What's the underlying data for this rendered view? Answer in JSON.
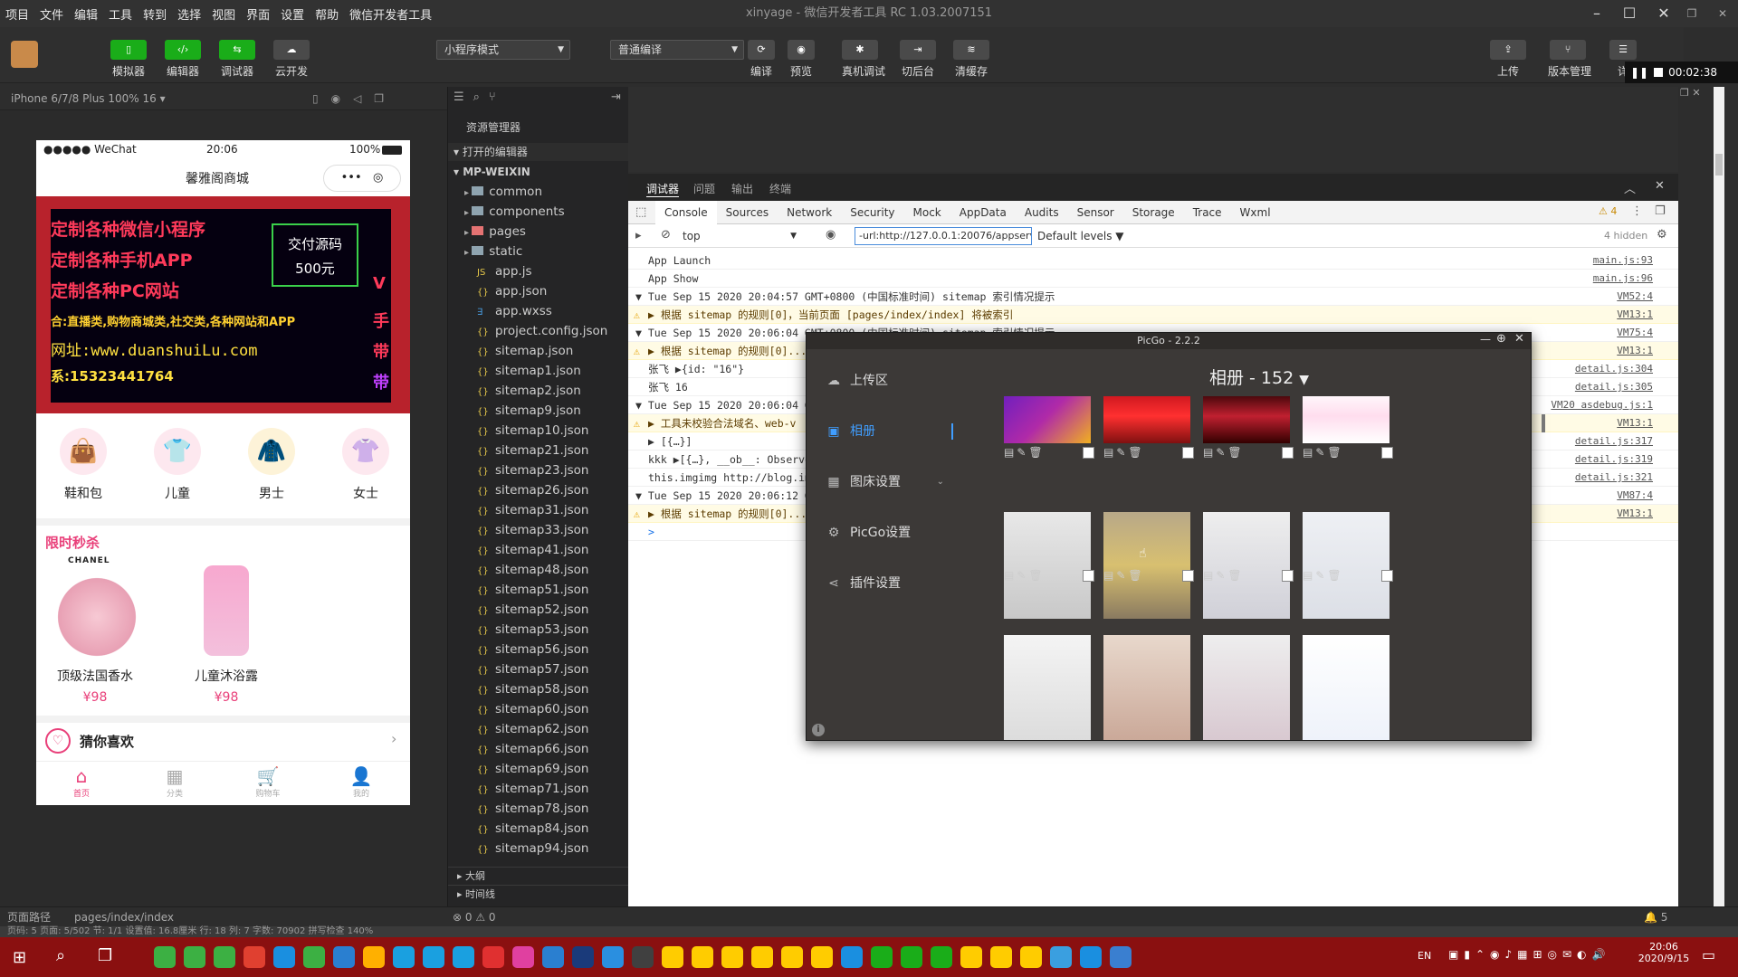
{
  "menu": [
    "项目",
    "文件",
    "编辑",
    "工具",
    "转到",
    "选择",
    "视图",
    "界面",
    "设置",
    "帮助",
    "微信开发者工具"
  ],
  "window_title": "xinyage - 微信开发者工具 RC 1.03.2007151",
  "toolbar": {
    "simulator": "模拟器",
    "editor": "编辑器",
    "debugger": "调试器",
    "cloud": "云开发",
    "mode_select": "小程序模式",
    "compile_select": "普通编译",
    "compile": "编译",
    "preview": "预览",
    "device_debug": "真机调试",
    "backend": "切后台",
    "clear_cache": "清缓存",
    "upload": "上传",
    "version": "版本管理",
    "detail": "详"
  },
  "recorder": {
    "time": "00:02:38"
  },
  "sim_header": "iPhone 6/7/8 Plus 100% 16 ▾",
  "phone": {
    "carrier": "●●●●● WeChat",
    "time": "20:06",
    "battery": "100%",
    "nav_title": "馨雅阁商城",
    "banner_lines": [
      "定制各种微信小程序",
      "定制各种手机APP",
      "定制各种PC网站",
      "合:直播类,购物商城类,社交类,各种网站和APP",
      "网址:www.duanshuiLu.com",
      "系:15323441764"
    ],
    "banner_box_l1": "交付源码",
    "banner_box_l2": "500元",
    "banner_side": [
      "V",
      "手",
      "带",
      "带"
    ],
    "categories": [
      "鞋和包",
      "儿童",
      "男士",
      "女士"
    ],
    "flash_title": "限时秒杀",
    "brand": "CHANEL",
    "products": [
      {
        "name": "顶级法国香水",
        "price": "¥98"
      },
      {
        "name": "儿童沐浴露",
        "price": "¥98"
      }
    ],
    "guess": "猜你喜欢",
    "tabs": [
      "首页",
      "分类",
      "购物车",
      "我的"
    ]
  },
  "explorer": {
    "title": "资源管理器",
    "open_editors": "打开的编辑器",
    "root": "MP-WEIXIN",
    "folders": [
      "common",
      "components",
      "pages",
      "static"
    ],
    "files": [
      "app.js",
      "app.json",
      "app.wxss",
      "project.config.json",
      "sitemap.json",
      "sitemap1.json",
      "sitemap2.json",
      "sitemap9.json",
      "sitemap10.json",
      "sitemap21.json",
      "sitemap23.json",
      "sitemap26.json",
      "sitemap31.json",
      "sitemap33.json",
      "sitemap41.json",
      "sitemap48.json",
      "sitemap51.json",
      "sitemap52.json",
      "sitemap53.json",
      "sitemap56.json",
      "sitemap57.json",
      "sitemap58.json",
      "sitemap60.json",
      "sitemap62.json",
      "sitemap66.json",
      "sitemap69.json",
      "sitemap71.json",
      "sitemap78.json",
      "sitemap84.json",
      "sitemap94.json"
    ],
    "outline": "大纲",
    "timeline": "时间线"
  },
  "panel_tabs": [
    "调试器",
    "问题",
    "输出",
    "终端"
  ],
  "devtools": {
    "tabs": [
      "Console",
      "Sources",
      "Network",
      "Security",
      "Mock",
      "AppData",
      "Audits",
      "Sensor",
      "Storage",
      "Trace",
      "Wxml"
    ],
    "warn_count": "4",
    "context": "top",
    "filter": "-url:http://127.0.0.1:20076/appservice/pa",
    "levels": "Default levels",
    "hidden": "4 hidden",
    "logs": [
      {
        "text": "App Launch",
        "src": "main.js:93",
        "type": "log"
      },
      {
        "text": "App Show",
        "src": "main.js:96",
        "type": "log"
      },
      {
        "text": "▼ Tue Sep 15 2020 20:04:57 GMT+0800 (中国标准时间) sitemap 索引情况提示",
        "src": "VM52:4",
        "type": "group"
      },
      {
        "text": "▶ 根据 sitemap 的规则[0]，当前页面 [pages/index/index] 将被索引",
        "src": "VM13:1",
        "type": "warn"
      },
      {
        "text": "▼ Tue Sep 15 2020 20:06:04 GMT+0800 (中国标准时间) sitemap 索引情况提示",
        "src": "VM75:4",
        "type": "group"
      },
      {
        "text": "▶ 根据 sitemap 的规则[0]...",
        "src": "VM13:1",
        "type": "warn"
      },
      {
        "text": "张飞 ▶{id: \"16\"}",
        "src": "detail.js:304",
        "type": "log"
      },
      {
        "text": "张飞 16",
        "src": "detail.js:305",
        "type": "log"
      },
      {
        "text": "▼ Tue Sep 15 2020 20:06:04 GM",
        "src": "VM20 asdebug.js:1",
        "type": "group"
      },
      {
        "text": "▶ 工具未校验合法域名、web-v",
        "src": "VM13:1",
        "type": "warn"
      },
      {
        "text": "▶ [{…}]",
        "src": "detail.js:317",
        "type": "log"
      },
      {
        "text": "kkk ▶[{…}, __ob__: Observe",
        "src": "detail.js:319",
        "type": "log"
      },
      {
        "text": "this.imgimg http://blog.im",
        "src": "detail.js:321",
        "type": "log"
      },
      {
        "text": "▼ Tue Sep 15 2020 20:06:12 GM",
        "src": "VM87:4",
        "type": "group"
      },
      {
        "text": "▶ 根据 sitemap 的规则[0]...",
        "src": "VM13:1",
        "type": "warn"
      },
      {
        "text": ">",
        "src": "",
        "type": "log"
      }
    ]
  },
  "picgo": {
    "title": "PicGo - 2.2.2",
    "album_title": "相册 - 152",
    "nav": [
      "上传区",
      "相册",
      "图床设置",
      "PicGo设置",
      "插件设置"
    ],
    "info": "i"
  },
  "status": {
    "path_label": "页面路径",
    "path": "pages/index/index",
    "errors": "⊗ 0 ⚠ 0",
    "notif": "5",
    "bottom": "页码: 5  页面: 5/502  节: 1/1  设置值: 16.8厘米  行: 18  列: 7  字数: 70902  拼写检查  140%"
  },
  "taskbar": {
    "lang": "EN",
    "time": "20:06",
    "date": "2020/9/15"
  }
}
